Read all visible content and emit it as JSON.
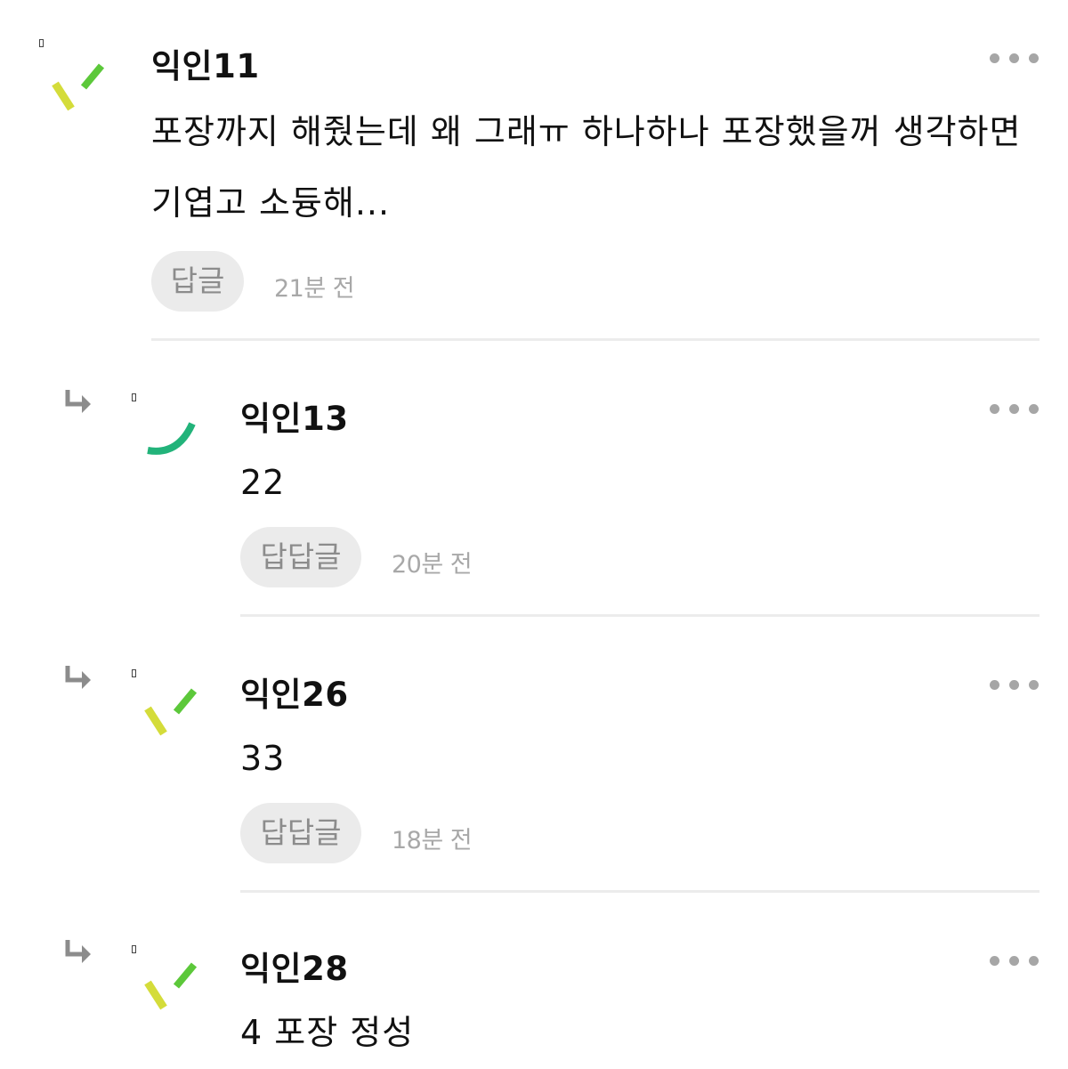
{
  "comments": [
    {
      "author": "익인11",
      "text": "포장까지 해줬는데 왜 그래ㅠ 하나하나 포장했을꺼 생각하면 기엽고 소듕해...",
      "reply_label": "답글",
      "time": "21분 전",
      "avatar": "confetti-icon",
      "is_reply": false
    },
    {
      "author": "익인13",
      "text": "22",
      "reply_label": "답답글",
      "time": "20분 전",
      "avatar": "arc-icon",
      "is_reply": true
    },
    {
      "author": "익인26",
      "text": "33",
      "reply_label": "답답글",
      "time": "18분 전",
      "avatar": "confetti-icon",
      "is_reply": true
    },
    {
      "author": "익인28",
      "text": "4 포장 정성",
      "avatar": "confetti-icon",
      "is_reply": true
    }
  ],
  "icons": {
    "more": "more-options-icon",
    "reply_arrow": "reply-arrow-icon"
  },
  "colors": {
    "avatar_yellow": "#d4dc3a",
    "avatar_green": "#5cc83a",
    "avatar_teal": "#22b37a",
    "reply_bg": "#ebebeb",
    "reply_text": "#8c8c8c",
    "time_text": "#a8a8a8",
    "divider": "#ececec",
    "more_dots": "#a6a6a6"
  }
}
